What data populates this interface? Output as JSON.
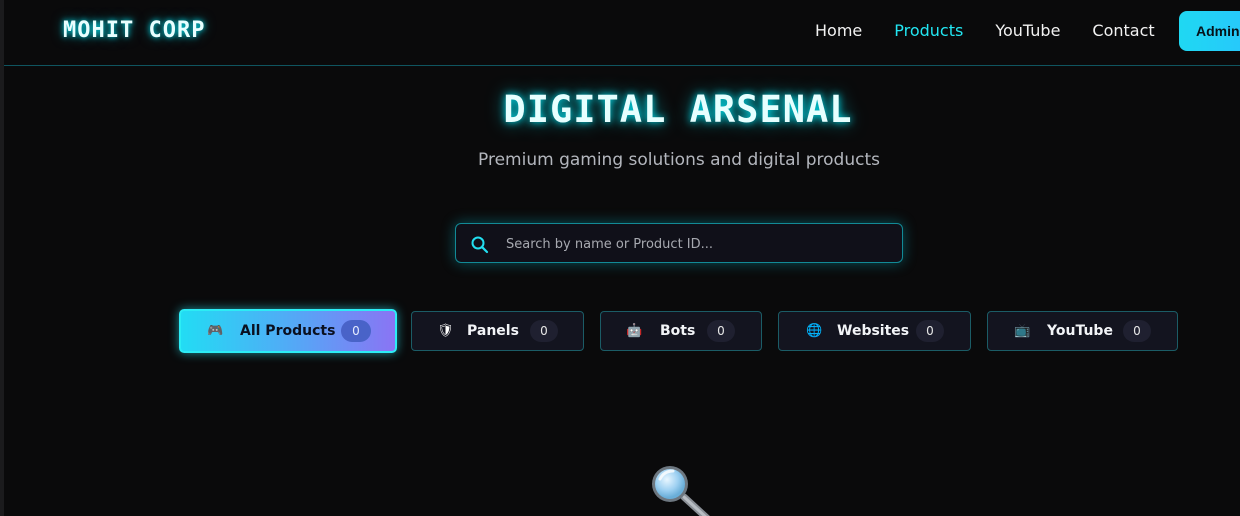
{
  "header": {
    "logo": "MOHIT CORP",
    "nav": [
      {
        "label": "Home",
        "active": false
      },
      {
        "label": "Products",
        "active": true
      },
      {
        "label": "YouTube",
        "active": false
      },
      {
        "label": "Contact",
        "active": false
      }
    ],
    "admin_label": "Admin"
  },
  "hero": {
    "title": "DIGITAL ARSENAL",
    "subtitle": "Premium gaming solutions and digital products"
  },
  "search": {
    "placeholder": "Search by name or Product ID...",
    "value": "",
    "icon": "search-icon"
  },
  "filters": [
    {
      "label": "All Products",
      "count": "0",
      "icon": "gamepad-icon",
      "glyph": "🎮",
      "active": true
    },
    {
      "label": "Panels",
      "count": "0",
      "icon": "shield-icon",
      "glyph": "🛡",
      "active": false
    },
    {
      "label": "Bots",
      "count": "0",
      "icon": "robot-icon",
      "glyph": "🤖",
      "active": false
    },
    {
      "label": "Websites",
      "count": "0",
      "icon": "globe-icon",
      "glyph": "🌐",
      "active": false
    },
    {
      "label": "YouTube",
      "count": "0",
      "icon": "tv-icon",
      "glyph": "📺",
      "active": false
    }
  ],
  "empty_state": {
    "icon": "magnifier-icon"
  },
  "colors": {
    "accent": "#22e6f2",
    "background": "#0a0a0b",
    "filter_bg": "#13141f",
    "filter_border": "#1b5c66"
  }
}
